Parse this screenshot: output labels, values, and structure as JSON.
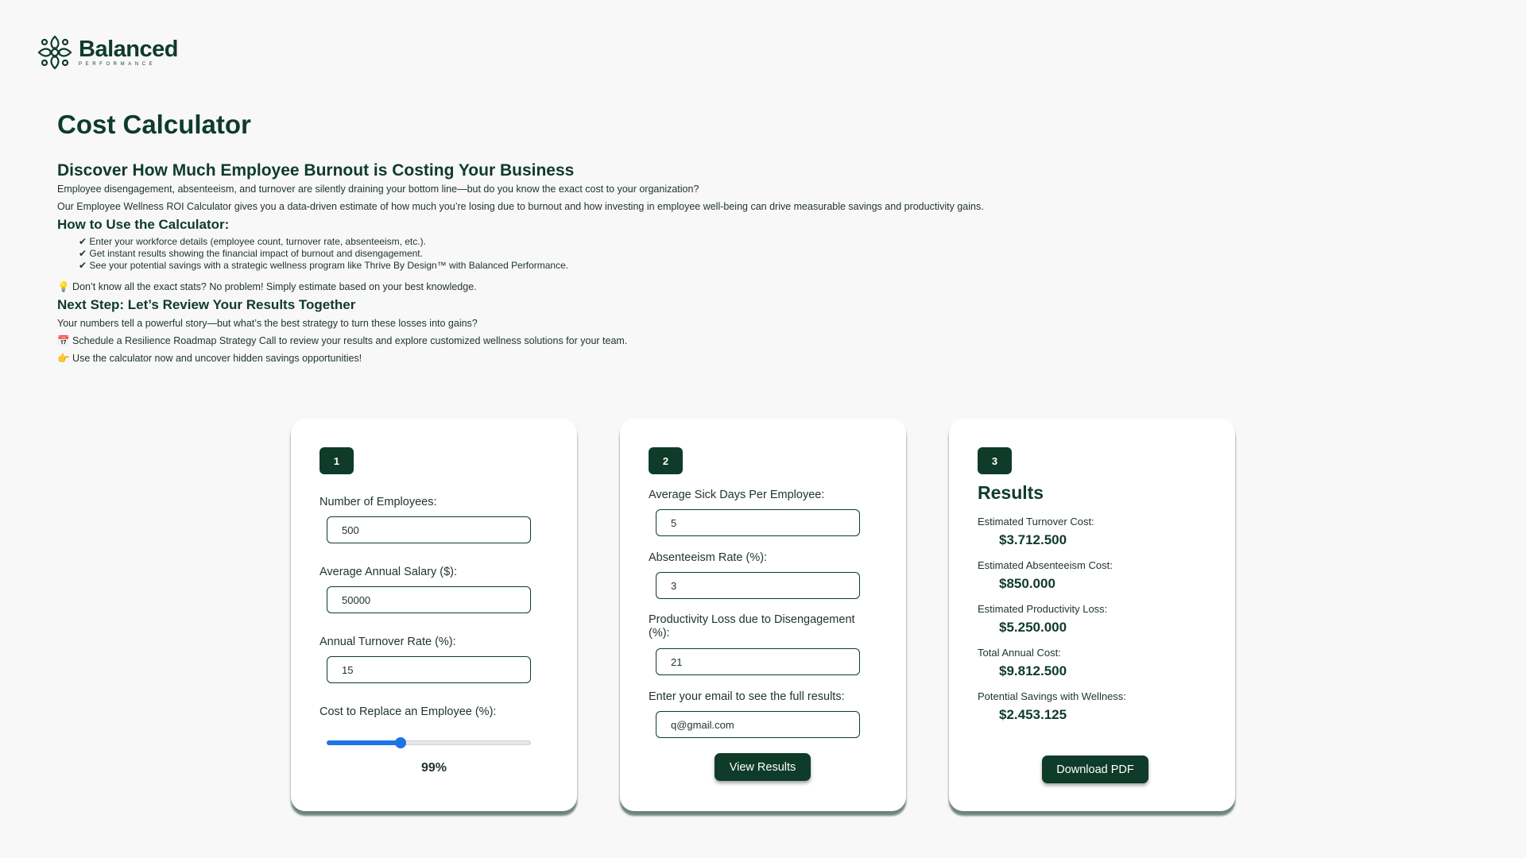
{
  "brand": {
    "name": "Balanced",
    "tagline": "PERFORMANCE",
    "logo_icon": "flourish-logo-icon"
  },
  "colors": {
    "primary": "#0f3b2a",
    "slider": "#1e74e6",
    "background": "#f8f8f8"
  },
  "intro": {
    "title": "Cost Calculator",
    "heading": "Discover How Much Employee Burnout is Costing Your Business",
    "p1": "Employee disengagement, absenteeism, and turnover are silently draining your bottom line—but do you know the exact cost to your organization?",
    "p2": "Our Employee Wellness ROI Calculator gives you a data-driven estimate of how much you’re losing due to burnout and how investing in employee well-being can drive measurable savings and productivity gains.",
    "how_title": "How to Use the Calculator:",
    "steps": [
      "✔ Enter your workforce details (employee count, turnover rate, absenteeism, etc.).",
      "✔ Get instant results showing the financial impact of burnout and disengagement.",
      "✔ See your potential savings with a strategic wellness program like Thrive By Design™ with Balanced Performance."
    ],
    "tip": "💡 Don’t know all the exact stats? No problem! Simply estimate based on your best knowledge.",
    "next_title": "Next Step: Let’s Review Your Results Together",
    "next_p": "Your numbers tell a powerful story—but what’s the best strategy to turn these losses into gains?",
    "schedule": "📅 Schedule a Resilience Roadmap Strategy Call to review your results and explore customized wellness solutions for your team.",
    "cta": "👉 Use the calculator now and uncover hidden savings opportunities!"
  },
  "card1": {
    "step": "1",
    "employees_label": "Number of Employees:",
    "employees_value": "500",
    "salary_label": "Average Annual Salary ($):",
    "salary_value": "50000",
    "turnover_label": "Annual Turnover Rate (%):",
    "turnover_value": "15",
    "replace_label": "Cost to Replace an Employee (%):",
    "replace_slider_fraction": 0.36,
    "replace_value": "99%"
  },
  "card2": {
    "step": "2",
    "sick_label": "Average Sick Days Per Employee:",
    "sick_value": "5",
    "absent_label": "Absenteeism Rate (%):",
    "absent_value": "3",
    "prod_label": "Productivity Loss due to Disengagement (%):",
    "prod_value": "21",
    "email_label": "Enter your email to see the full results:",
    "email_value": "q@gmail.com",
    "button": "View Results"
  },
  "card3": {
    "step": "3",
    "title": "Results",
    "items": [
      {
        "label": "Estimated Turnover Cost:",
        "value": "$3.712.500"
      },
      {
        "label": "Estimated Absenteeism Cost:",
        "value": "$850.000"
      },
      {
        "label": "Estimated Productivity Loss:",
        "value": "$5.250.000"
      },
      {
        "label": "Total Annual Cost:",
        "value": "$9.812.500"
      },
      {
        "label": "Potential Savings with Wellness:",
        "value": "$2.453.125"
      }
    ],
    "button": "Download PDF"
  }
}
